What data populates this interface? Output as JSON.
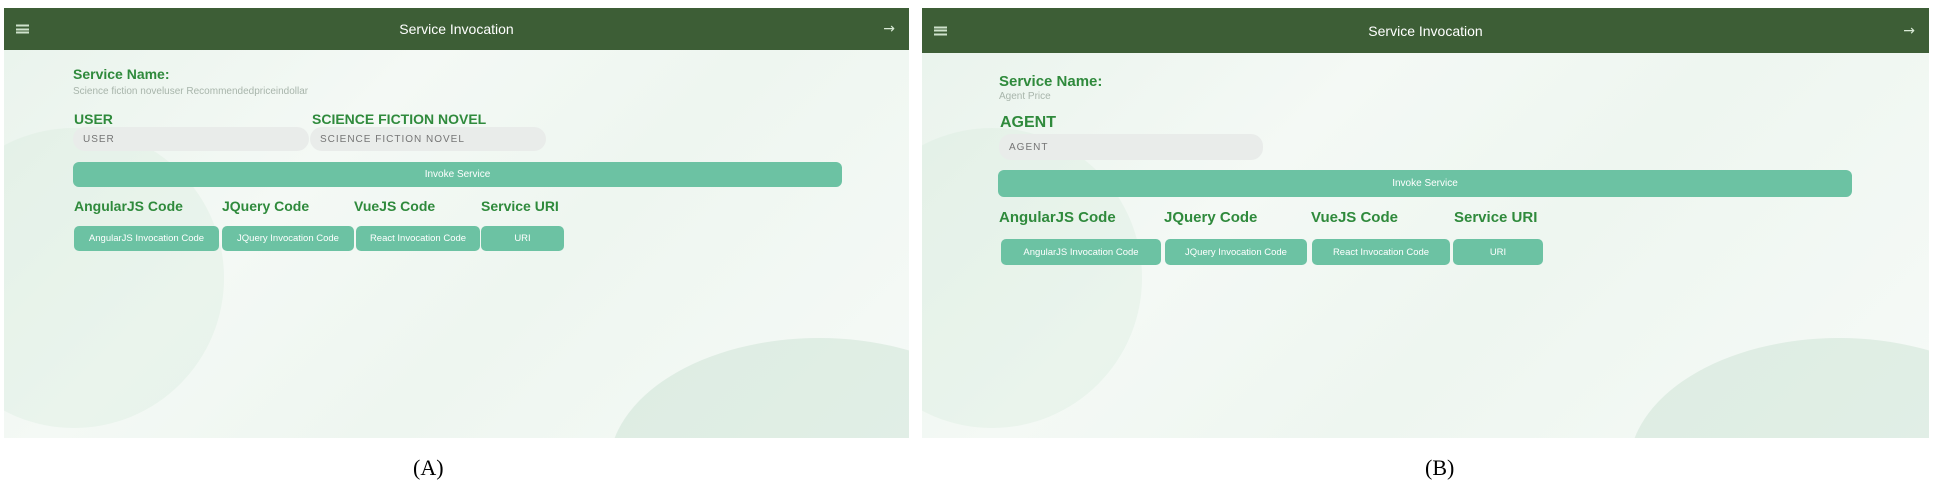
{
  "panel_a": {
    "title": "Service Invocation",
    "service_name_label": "Service Name:",
    "service_name_value": "Science fiction noveluser Recommendedpriceindollar",
    "params": [
      {
        "label": "USER",
        "placeholder": "USER"
      },
      {
        "label": "SCIENCE FICTION NOVEL",
        "placeholder": "SCIENCE FICTION NOVEL"
      }
    ],
    "invoke_label": "Invoke Service",
    "code_headers": [
      "AngularJS Code",
      "JQuery Code",
      "VueJS Code",
      "Service URI"
    ],
    "code_buttons": [
      "AngularJS Invocation Code",
      "JQuery Invocation Code",
      "React Invocation Code",
      "URI"
    ]
  },
  "panel_b": {
    "title": "Service Invocation",
    "service_name_label": "Service Name:",
    "service_name_value": "Agent Price",
    "params": [
      {
        "label": "AGENT",
        "placeholder": "AGENT"
      }
    ],
    "invoke_label": "Invoke Service",
    "code_headers": [
      "AngularJS Code",
      "JQuery Code",
      "VueJS Code",
      "Service URI"
    ],
    "code_buttons": [
      "AngularJS Invocation Code",
      "JQuery Invocation Code",
      "React Invocation Code",
      "URI"
    ]
  },
  "captions": {
    "a": "(A)",
    "b": "(B)"
  },
  "colors": {
    "topbar": "#3d5e36",
    "accent_green": "#2f8a3c",
    "button": "#6cc2a3"
  },
  "icons": {
    "menu": "menu-icon",
    "arrow": "arrow-right-icon"
  }
}
